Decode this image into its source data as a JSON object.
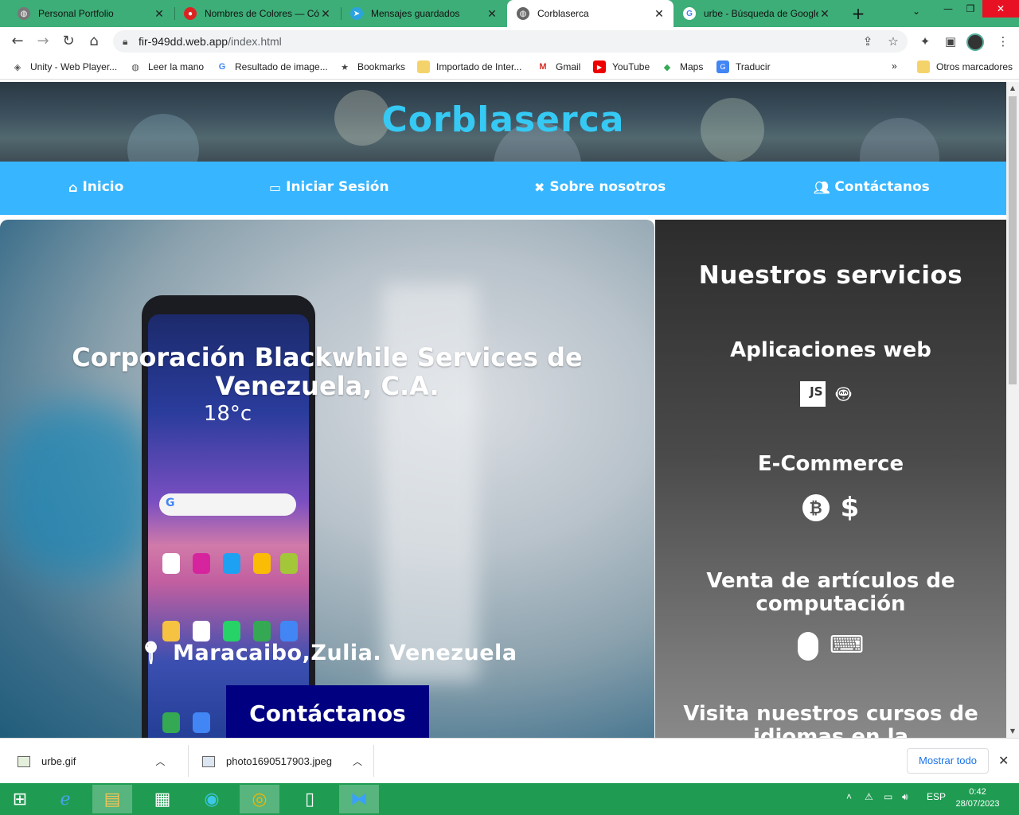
{
  "browser": {
    "tabs": [
      {
        "title": "Personal Portfolio",
        "favicon": "globe-icon"
      },
      {
        "title": "Nombres de Colores — Códi",
        "favicon": "site-icon"
      },
      {
        "title": "Mensajes guardados",
        "favicon": "telegram-icon"
      },
      {
        "title": "Corblaserca",
        "favicon": "globe-icon",
        "active": true
      },
      {
        "title": "urbe - Búsqueda de Google",
        "favicon": "google-icon"
      }
    ],
    "url_host": "fir-949dd.web.app",
    "url_path": "/index.html",
    "bookmarks": [
      {
        "label": "Unity - Web Player...",
        "icon": "unity-icon"
      },
      {
        "label": "Leer la mano",
        "icon": "globe-icon"
      },
      {
        "label": "Resultado de image...",
        "icon": "google-icon"
      },
      {
        "label": "Bookmarks",
        "icon": "star-icon"
      },
      {
        "label": "Importado de Inter...",
        "icon": "folder-icon"
      },
      {
        "label": "Gmail",
        "icon": "gmail-icon"
      },
      {
        "label": "YouTube",
        "icon": "youtube-icon"
      },
      {
        "label": "Maps",
        "icon": "maps-icon"
      },
      {
        "label": "Traducir",
        "icon": "translate-icon"
      }
    ],
    "bookmarks_overflow": "»",
    "other_bookmarks": "Otros marcadores"
  },
  "site": {
    "title": "Corblaserca",
    "nav": [
      {
        "label": "Inicio",
        "icon": "home-icon"
      },
      {
        "label": "Iniciar Sesión",
        "icon": "laptop-icon"
      },
      {
        "label": "Sobre nosotros",
        "icon": "tools-icon"
      },
      {
        "label": "Contáctanos",
        "icon": "users-icon"
      }
    ],
    "hero": {
      "title": "Corporación Blackwhile Services de Venezuela, C.A.",
      "location": "Maracaibo,Zulia. Venezuela",
      "cta": "Contáctanos"
    },
    "services": {
      "title": "Nuestros servicios",
      "items": [
        {
          "heading": "Aplicaciones web",
          "icons": [
            "js-icon",
            "android-icon",
            "apple-icon"
          ]
        },
        {
          "heading": "E-Commerce",
          "icons": [
            "bitcoin-icon",
            "dollar-icon"
          ]
        },
        {
          "heading": "Venta de artículos de computación",
          "icons": [
            "mouse-icon",
            "keyboard-icon"
          ]
        },
        {
          "heading": "Visita nuestros cursos de idiomas en la",
          "icons": []
        }
      ]
    },
    "phone": {
      "time": "18°c"
    }
  },
  "downloads": {
    "items": [
      {
        "name": "urbe.gif"
      },
      {
        "name": "photo1690517903.jpeg"
      }
    ],
    "show_all": "Mostrar todo"
  },
  "taskbar": {
    "lang": "ESP",
    "time": "0:42",
    "date": "28/07/2023"
  },
  "colors": {
    "title_cyan": "#35c9f4",
    "nav_blue": "#37b6ff",
    "cta_navy": "#000080",
    "tab_strip_green": "#3dae78"
  }
}
